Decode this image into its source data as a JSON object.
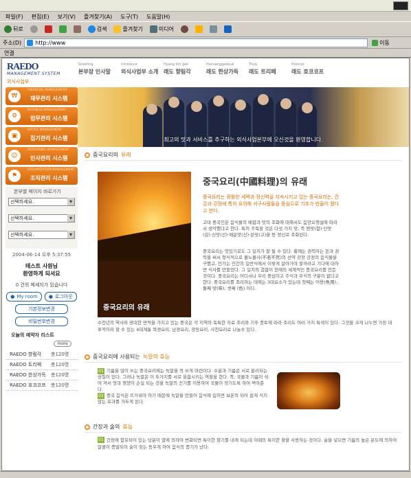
{
  "menubar": [
    "파일(F)",
    "편집(E)",
    "보기(V)",
    "즐겨찾기(A)",
    "도구(T)",
    "도움말(H)"
  ],
  "toolbar": {
    "back": "뒤로",
    "search": "검색",
    "favorites": "즐겨찾기",
    "media": "미디어"
  },
  "address": {
    "label": "주소(D)",
    "url": "http://www",
    "go": "이동"
  },
  "links": "연결",
  "logo": {
    "brand": "RAEDO",
    "subtitle": "MANAGEMENT SYSTEM",
    "division": "외식사업부"
  },
  "nav": [
    {
      "en": "Greeting",
      "ko": "본부장 인사말"
    },
    {
      "en": "Introduce",
      "ko": "외식사업부 소개"
    },
    {
      "en": "Hyang lim gak",
      "ko": "래도 향림각"
    },
    {
      "en": "Hansanggadeuk",
      "ko": "래도 한상가득"
    },
    {
      "en": "Trula",
      "ko": "래도 트리페"
    },
    {
      "en": "Hoocoo",
      "ko": "래도 호코코프"
    }
  ],
  "sidemenu": [
    {
      "en": "FINANCIAL MANAGEMENT",
      "ko": "재무관리 시스템"
    },
    {
      "en": "BUSINESS MANAGEMENT",
      "ko": "업무관리 시스템"
    },
    {
      "en": "OFFICE MANAGEMENT",
      "ko": "집기관리 시스템"
    },
    {
      "en": "PERSONNEL MANAGEMENT",
      "ko": "인사관리 시스템"
    },
    {
      "en": "ORGANIZATION MANAGEMENT",
      "ko": "조직관리 시스템"
    }
  ],
  "quick": {
    "heading": "본부별 페이지 바로가기",
    "selects": [
      "선택하세요.",
      "선택하세요.",
      "선택하세요."
    ]
  },
  "user": {
    "datetime": "2004-06-14 오후 5:37:55",
    "greeting1": "테스트 사원님",
    "greeting2": "환영하게 되셔요",
    "messages": "0 건의 메세지가 있습니다",
    "myroom": "My room",
    "logout": "로그아웃",
    "basic_info": "기본정보변경",
    "password": "비밀번호변경"
  },
  "reservation": {
    "heading": "오늘의 예약자 리스트",
    "more": "more",
    "items": [
      {
        "name": "RAEDO 향림각",
        "count": "총120명"
      },
      {
        "name": "RAEDO 트리페",
        "count": "총120명"
      },
      {
        "name": "RAEDO 한상가득",
        "count": "총120명"
      },
      {
        "name": "RAEDO 호코코프",
        "count": "총120명"
      }
    ]
  },
  "banner": {
    "caption": "최고의 맛과 서비스를 추구하는 외식사업본부에 오신것을 환영합니다."
  },
  "section1": {
    "title_pre": "중국요리의",
    "title_hl": "유래",
    "img_caption": "중국요리의 유래",
    "main_title": "중국요리(中國料理)의 유래",
    "intro": "중국요리는 광활한 세력과 정신력을 지속시키고 있는 중국요리는, 건강과 강장에 특히 유의해 서구사람들을 중심으로 기초가 만들어 졌다고 한다.",
    "p1": "고대 중국인은 음식물의 배합과 맛의 조화에 대해서도 음양오행설에 따라서 생각했다고 한다. 특히 주목할 것은 다섯 가지 맛, 즉 짠맛(함)·단맛(감)·신맛(산)·매운맛(신)·쓴맛(고)을 등 정신로 조화된다.",
    "p2": "중국요리는 맛있기로도 그 일치가 잘 될 수 있다. 황제는 권력자는 돈과 권력을 써서 형식적으로 불노불사(不老不死)의 선약 강장 강정의 음식물을 구했고, 민가는 민간의 일반식에서 이렇게 살아가야 할까라고 기다에 대하면 식사를 만들었다. 그 일치의 결합이 현재의 세계적인 중국요리를 만든 것이다. 중국요리는 어디서나 우리 중심이고 주식과 부식의 구분이 없다고 한다. 중국요리를 조리하는 데에는 3대요소가 있는데 첫째는 어용(魚用), 둘째 맛(味), 셋째 (色) 이다.",
    "full": "수천년의 역사와 광대한 면적을 가지고 있는 중국은 각 지역의 독특한 자료 조리와 기후 풍토에 따라 조리도 여러 가지 특색이 있다. 그것을 크게 나누면 가장 대표적이라 할 수 있는 4대계통 북경요리, 남경요리, 광동요리, 사천요리로 나눌수 있다."
  },
  "section2": {
    "title_pre": "중국요리에 사용되는",
    "title_hl": "녹말의 효능",
    "e1_num": "01",
    "e1": "기름을 많이 쓰는 중국요리에는 녹말을 꼭 쓰게 마련이다. 수분과 기름은 서로 분리되는 성질이 있다. 그러나 녹말은 이 두가지를 서로 융합시키는 역할을 한다. 즉, 국물과 기름이 섞여 져서 맛과 영양이 손실 되는 것을 녹말의 끈기를 이용하여 국물이 엉기도록 하여 막아준다.",
    "e2_num": "02",
    "e2": "중국 음식은 뜨거워야 하기 때문에 녹말을 만들어 음식에 입히면 보온의 되어 쉽게 식지 않는 효과를 가두게 된다."
  },
  "section3": {
    "title_pre": "간장과 술의",
    "title_hl": "효능",
    "e1_num": "01",
    "e1": "간장에 함유되어 있는 당분이 열에 의하여 변화되면 특이한 향기를 내게 되는데 이때의 특이한 향을 사용하는 것이다. 술을 넣으면 기름의 높은 온도에 의하여 알콜이 증발되어 술이 갖는 동우게 하여 음식의 풍기가 난다."
  }
}
